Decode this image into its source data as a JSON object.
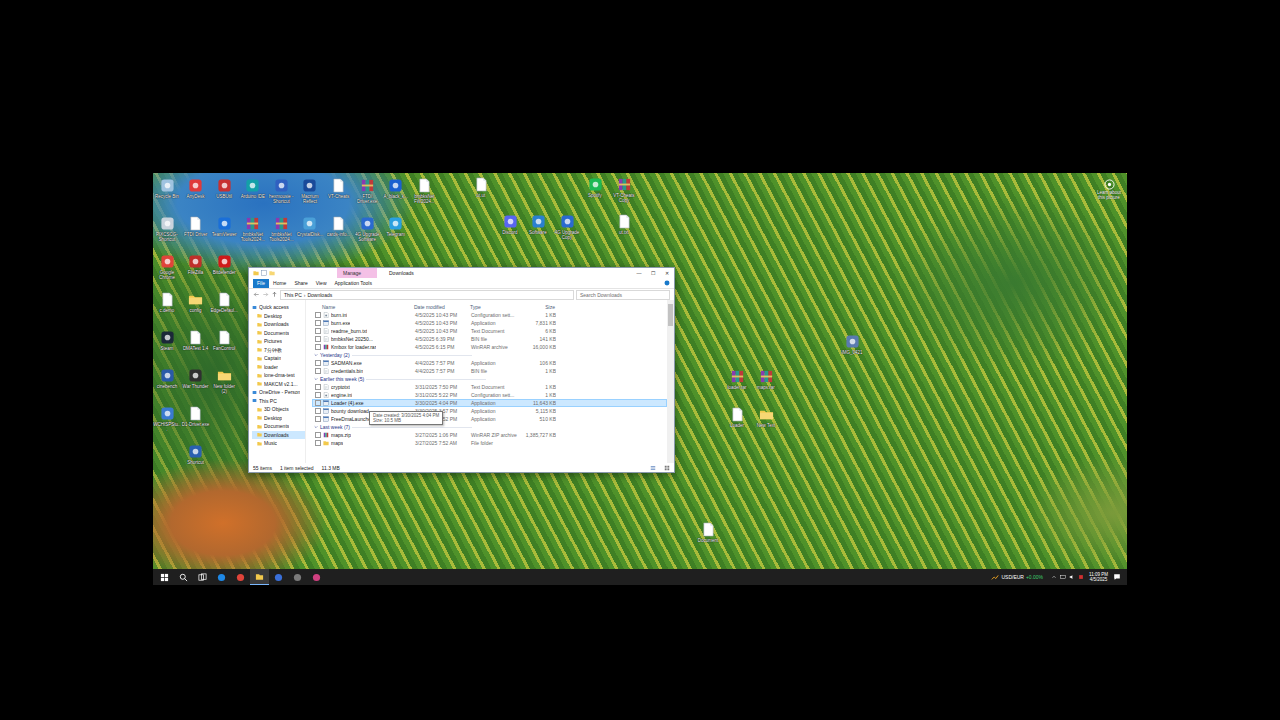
{
  "desktop": {
    "icon_columns": [
      [
        {
          "label": "Recycle Bin",
          "kind": "app",
          "color": "#9fc3e0"
        },
        {
          "label": "PIXCSCG-Shortcut",
          "kind": "app",
          "color": "#c9d3dd"
        },
        {
          "label": "Google Chrome",
          "kind": "app",
          "color": "#e0443a"
        },
        {
          "label": "c.demo",
          "kind": "file"
        },
        {
          "label": "Steam",
          "kind": "app",
          "color": "#1b2838"
        },
        {
          "label": "cinebench",
          "kind": "app",
          "color": "#2a5aa8"
        },
        {
          "label": "WCHISPStu...",
          "kind": "app",
          "color": "#3a7ad0"
        }
      ],
      [
        {
          "label": "AnyDesk",
          "kind": "app",
          "color": "#e03a3a"
        },
        {
          "label": "FTDI Driver",
          "kind": "file"
        },
        {
          "label": "FileZilla",
          "kind": "app",
          "color": "#c0302a"
        },
        {
          "label": "config",
          "kind": "folder"
        },
        {
          "label": "DMATest 1.4",
          "kind": "file"
        },
        {
          "label": "War Thunder",
          "kind": "app",
          "color": "#303030"
        },
        {
          "label": "D1-Driver.exe",
          "kind": "file"
        },
        {
          "label": "Shortcut",
          "kind": "app",
          "color": "#2a60b0"
        }
      ],
      [
        {
          "label": "USBUtil",
          "kind": "app",
          "color": "#c83030"
        },
        {
          "label": "TeamViewer",
          "kind": "app",
          "color": "#1a6fd8"
        },
        {
          "label": "Bitdefender",
          "kind": "app",
          "color": "#d01a1a"
        },
        {
          "label": "EdgeDefaul...",
          "kind": "file"
        },
        {
          "label": "FanControl",
          "kind": "file"
        },
        {
          "label": "New folder (2)",
          "kind": "folder"
        }
      ],
      [
        {
          "label": "Arduino IDE",
          "kind": "app",
          "color": "#13a0a8"
        },
        {
          "label": "bmbksNet Tools2024...",
          "kind": "archive"
        }
      ],
      [
        {
          "label": "hexmousie - Shortcut",
          "kind": "app",
          "color": "#3060c0"
        },
        {
          "label": "bmbksNet Tools2024...",
          "kind": "archive"
        }
      ],
      [
        {
          "label": "Macrium Reflect",
          "kind": "app",
          "color": "#1a4a9a"
        },
        {
          "label": "CrystalDisk...",
          "kind": "app",
          "color": "#4aa0d8"
        }
      ],
      [
        {
          "label": "VT-Cheats",
          "kind": "file"
        },
        {
          "label": "cards-info...",
          "kind": "file"
        }
      ],
      [
        {
          "label": "FTDI Driver.exe",
          "kind": "archive"
        },
        {
          "label": "4G Upgrade Software",
          "kind": "app",
          "color": "#2a6ad0"
        }
      ],
      [
        {
          "label": "A_black_k...",
          "kind": "app",
          "color": "#1a60d0"
        },
        {
          "label": "Telegram",
          "kind": "app",
          "color": "#2aa0e0"
        }
      ],
      [
        {
          "label": "bmbksNet FW2024...",
          "kind": "file"
        }
      ]
    ],
    "scattered_icons": [
      {
        "label": "ut.ut",
        "kind": "file"
      },
      {
        "label": "Spotify",
        "kind": "app",
        "color": "#1db954"
      },
      {
        "label": "VT-Cheats Copy",
        "kind": "archive"
      },
      {
        "label": "Discord",
        "kind": "app",
        "color": "#5865f2"
      },
      {
        "label": "Software",
        "kind": "app",
        "color": "#2a80d0"
      },
      {
        "label": "4G Upgrade Copy",
        "kind": "app",
        "color": "#2a6ad0"
      },
      {
        "label": "ut.txt",
        "kind": "file"
      },
      {
        "label": "IMG_0421",
        "kind": "app",
        "color": "#5a7ab0"
      },
      {
        "label": "loader.rar",
        "kind": "archive"
      },
      {
        "label": "maps.rar",
        "kind": "archive"
      },
      {
        "label": "Loader",
        "kind": "file"
      },
      {
        "label": "New Text",
        "kind": "folder"
      },
      {
        "label": "Document",
        "kind": "file"
      }
    ],
    "learn": {
      "label": "Learn about this picture"
    }
  },
  "explorer": {
    "title": "Downloads",
    "context_label": "Manage",
    "controls": [
      "—",
      "☐",
      "✕"
    ],
    "ribbon": {
      "file_tab": "File",
      "tabs": [
        "Home",
        "Share",
        "View",
        "Application Tools"
      ]
    },
    "address": {
      "parts": [
        "This PC",
        "Downloads"
      ],
      "separator": "›"
    },
    "search": {
      "placeholder": "Search Downloads"
    },
    "nav": [
      {
        "label": "Quick access",
        "kind": "root",
        "selected": false
      },
      {
        "label": "Desktop",
        "kind": "child",
        "selected": false
      },
      {
        "label": "Downloads",
        "kind": "child",
        "selected": false
      },
      {
        "label": "Documents",
        "kind": "child",
        "selected": false
      },
      {
        "label": "Pictures",
        "kind": "child",
        "selected": false
      },
      {
        "label": "7分钟教",
        "kind": "child",
        "selected": false
      },
      {
        "label": "Captain",
        "kind": "child",
        "selected": false
      },
      {
        "label": "loader",
        "kind": "child",
        "selected": false
      },
      {
        "label": "lone-dma-test",
        "kind": "child",
        "selected": false
      },
      {
        "label": "MAKCM v2.1...",
        "kind": "child",
        "selected": false
      },
      {
        "label": "OneDrive - Person",
        "kind": "root",
        "selected": false
      },
      {
        "label": "This PC",
        "kind": "root",
        "selected": false
      },
      {
        "label": "3D Objects",
        "kind": "child",
        "selected": false
      },
      {
        "label": "Desktop",
        "kind": "child",
        "selected": false
      },
      {
        "label": "Documents",
        "kind": "child",
        "selected": false
      },
      {
        "label": "Downloads",
        "kind": "child",
        "selected": true
      },
      {
        "label": "Music",
        "kind": "child",
        "selected": false
      }
    ],
    "columns": [
      "Name",
      "Date modified",
      "Type",
      "Size"
    ],
    "groups": [
      {
        "header": "",
        "rows": [
          {
            "name": "burn.ini",
            "date": "4/5/2025 10:43 PM",
            "type": "Configuration sett...",
            "size": "1 KB",
            "kind": "config",
            "selected": false
          },
          {
            "name": "burn.exe",
            "date": "4/5/2025 10:43 PM",
            "type": "Application",
            "size": "7,831 KB",
            "kind": "exe",
            "selected": false
          },
          {
            "name": "readme_burn.txt",
            "date": "4/5/2025 10:43 PM",
            "type": "Text Document",
            "size": "6 KB",
            "kind": "text",
            "selected": false
          },
          {
            "name": "bmbksNet 20250...",
            "date": "4/5/2025 6:39 PM",
            "type": "BIN file",
            "size": "141 KB",
            "kind": "bin",
            "selected": false
          },
          {
            "name": "Kmbox for loader.rar",
            "date": "4/5/2025 6:15 PM",
            "type": "WinRAR archive",
            "size": "16,000 KB",
            "kind": "archive",
            "selected": false
          }
        ]
      },
      {
        "header": "Yesterday (2)",
        "rows": [
          {
            "name": "SADMAN.exe",
            "date": "4/4/2025 7:57 PM",
            "type": "Application",
            "size": "106 KB",
            "kind": "exe",
            "selected": false
          },
          {
            "name": "credentials.bin",
            "date": "4/4/2025 7:57 PM",
            "type": "BIN file",
            "size": "1 KB",
            "kind": "bin",
            "selected": false
          }
        ]
      },
      {
        "header": "Earlier this week (5)",
        "rows": [
          {
            "name": "cryptotxt",
            "date": "3/31/2025 7:50 PM",
            "type": "Text Document",
            "size": "1 KB",
            "kind": "text",
            "selected": false
          },
          {
            "name": "engine.ini",
            "date": "3/31/2025 5:22 PM",
            "type": "Configuration sett...",
            "size": "1 KB",
            "kind": "config",
            "selected": false
          },
          {
            "name": "Loader (4).exe",
            "date": "3/30/2025 4:04 PM",
            "type": "Application",
            "size": "11,643 KB",
            "kind": "exe",
            "selected": true
          },
          {
            "name": "bounty download",
            "date": "3/30/2025 3:57 PM",
            "type": "Application",
            "size": "5,115 KB",
            "kind": "exe",
            "selected": false
          },
          {
            "name": "FreeDmaLauncher.exe",
            "date": "3/30/2025 3:52 PM",
            "type": "Application",
            "size": "510 KB",
            "kind": "exe",
            "selected": false
          }
        ]
      },
      {
        "header": "Last week (7)",
        "rows": [
          {
            "name": "maps.zip",
            "date": "3/27/2025 1:06 PM",
            "type": "WinRAR ZIP archive",
            "size": "1,385,727 KB",
            "kind": "archive",
            "selected": false
          },
          {
            "name": "maps",
            "date": "3/27/2025 7:52 AM",
            "type": "File folder",
            "size": "",
            "kind": "folder",
            "selected": false
          }
        ]
      }
    ],
    "tooltip": [
      "Date created: 3/30/2025 4:04 PM",
      "Size: 10.5 MB"
    ],
    "status": [
      "55 items",
      "1 item selected",
      "11.3 MB"
    ]
  },
  "taskbar": {
    "items": [
      {
        "kind": "start",
        "selected": false
      },
      {
        "kind": "search",
        "selected": false
      },
      {
        "kind": "taskview",
        "selected": false
      },
      {
        "kind": "app",
        "color": "#1e88e5",
        "selected": false
      },
      {
        "kind": "app",
        "color": "#e0443a",
        "selected": false
      },
      {
        "kind": "folder",
        "selected": true
      },
      {
        "kind": "app",
        "color": "#3a6fd8",
        "selected": false
      },
      {
        "kind": "app",
        "color": "#7a7a7a",
        "selected": false
      },
      {
        "kind": "app",
        "color": "#d04080",
        "selected": false
      }
    ],
    "ticker": {
      "pair": "USD/EUR",
      "change": "+0.00%"
    },
    "time": "11:09 PM",
    "date": "4/5/2025"
  }
}
